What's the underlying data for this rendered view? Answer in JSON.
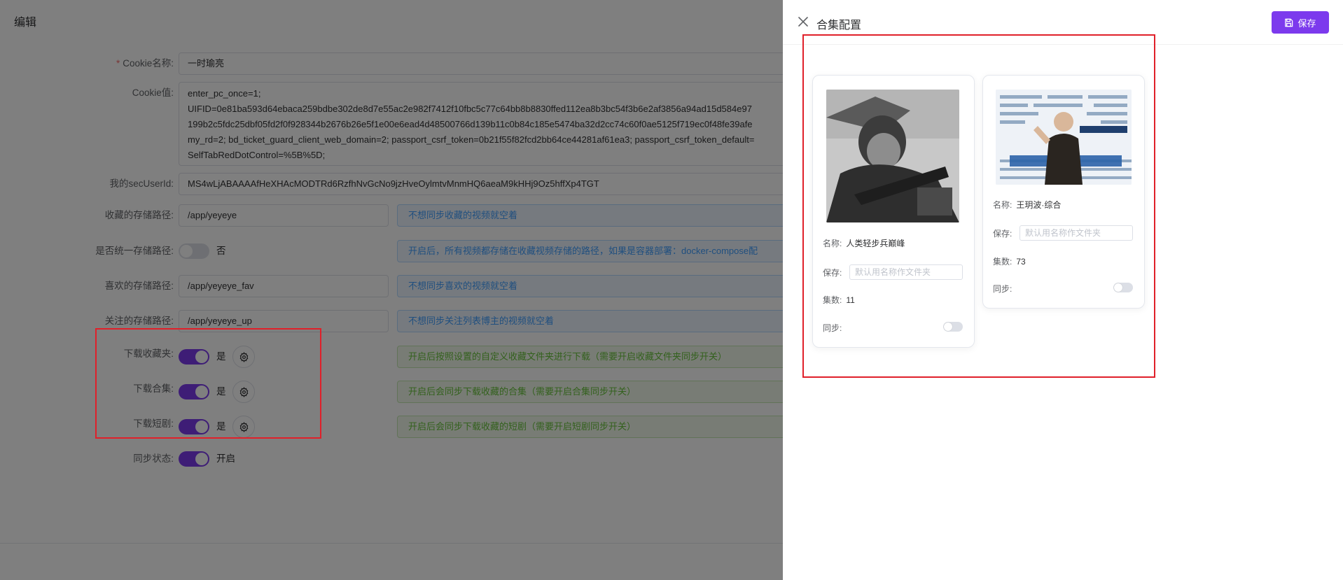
{
  "editor": {
    "title": "编辑",
    "cookie_name": {
      "required_mark": "*",
      "label": "Cookie名称:",
      "value": "一时瑜亮"
    },
    "cookie_value": {
      "label": "Cookie值:",
      "lines": [
        "enter_pc_once=1;",
        "UIFID=0e81ba593d64ebaca259bdbe302de8d7e55ac2e982f7412f10fbc5c77c64bb8b8830ffed112ea8b3bc54f3b6e2af3856a94ad15d584e97",
        "199b2c5fdc25dbf05fd2f0f928344b2676b26e5f1e00e6ead4d48500766d139b11c0b84c185e5474ba32d2cc74c60f0ae5125f719ec0f48fe39afe",
        "my_rd=2; bd_ticket_guard_client_web_domain=2; passport_csrf_token=0b21f55f82fcd2bb64ce44281af61ea3; passport_csrf_token_default=",
        "SelfTabRedDotControl=%5B%5D;"
      ]
    },
    "sec_user_id": {
      "label": "我的secUserId:",
      "value": "MS4wLjABAAAAfHeXHAcMODTRd6RzfhNvGcNo9jzHveOylmtvMnmHQ6aeaM9kHHj9Oz5hffXp4TGT"
    },
    "fav_path": {
      "label": "收藏的存储路径:",
      "value": "/app/yeyeye",
      "hint": "不想同步收藏的视频就空着"
    },
    "unify_path": {
      "label": "是否统一存储路径:",
      "state": "否",
      "hint": "开启后，所有视频都存储在收藏视频存储的路径，如果是容器部署：docker-compose配"
    },
    "like_path": {
      "label": "喜欢的存储路径:",
      "value": "/app/yeyeye_fav",
      "hint": "不想同步喜欢的视频就空着"
    },
    "follow_path": {
      "label": "关注的存储路径:",
      "value": "/app/yeyeye_up",
      "hint": "不想同步关注列表博主的视频就空着"
    },
    "download_fav_folder": {
      "label": "下载收藏夹:",
      "state": "是",
      "hint": "开启后按照设置的自定义收藏文件夹进行下载（需要开启收藏文件夹同步开关）"
    },
    "download_collection": {
      "label": "下载合集:",
      "state": "是",
      "hint": "开启后会同步下载收藏的合集（需要开启合集同步开关）"
    },
    "download_short_drama": {
      "label": "下载短剧:",
      "state": "是",
      "hint": "开启后会同步下载收藏的短剧（需要开启短剧同步开关）"
    },
    "sync_status": {
      "label": "同步状态:",
      "state": "开启"
    }
  },
  "drawer": {
    "title": "合集配置",
    "save_label": "保存",
    "accent": "#7c3aed",
    "cards": [
      {
        "name_label": "名称:",
        "name": "人类轻步兵巅峰",
        "save_label": "保存:",
        "save_placeholder": "默认用名称作文件夹",
        "count_label": "集数:",
        "count": "11",
        "sync_label": "同步:",
        "sync_on": false
      },
      {
        "name_label": "名称:",
        "name": "王玥波·综合",
        "save_label": "保存:",
        "save_placeholder": "默认用名称作文件夹",
        "count_label": "集数:",
        "count": "73",
        "sync_label": "同步:",
        "sync_on": false
      }
    ]
  }
}
